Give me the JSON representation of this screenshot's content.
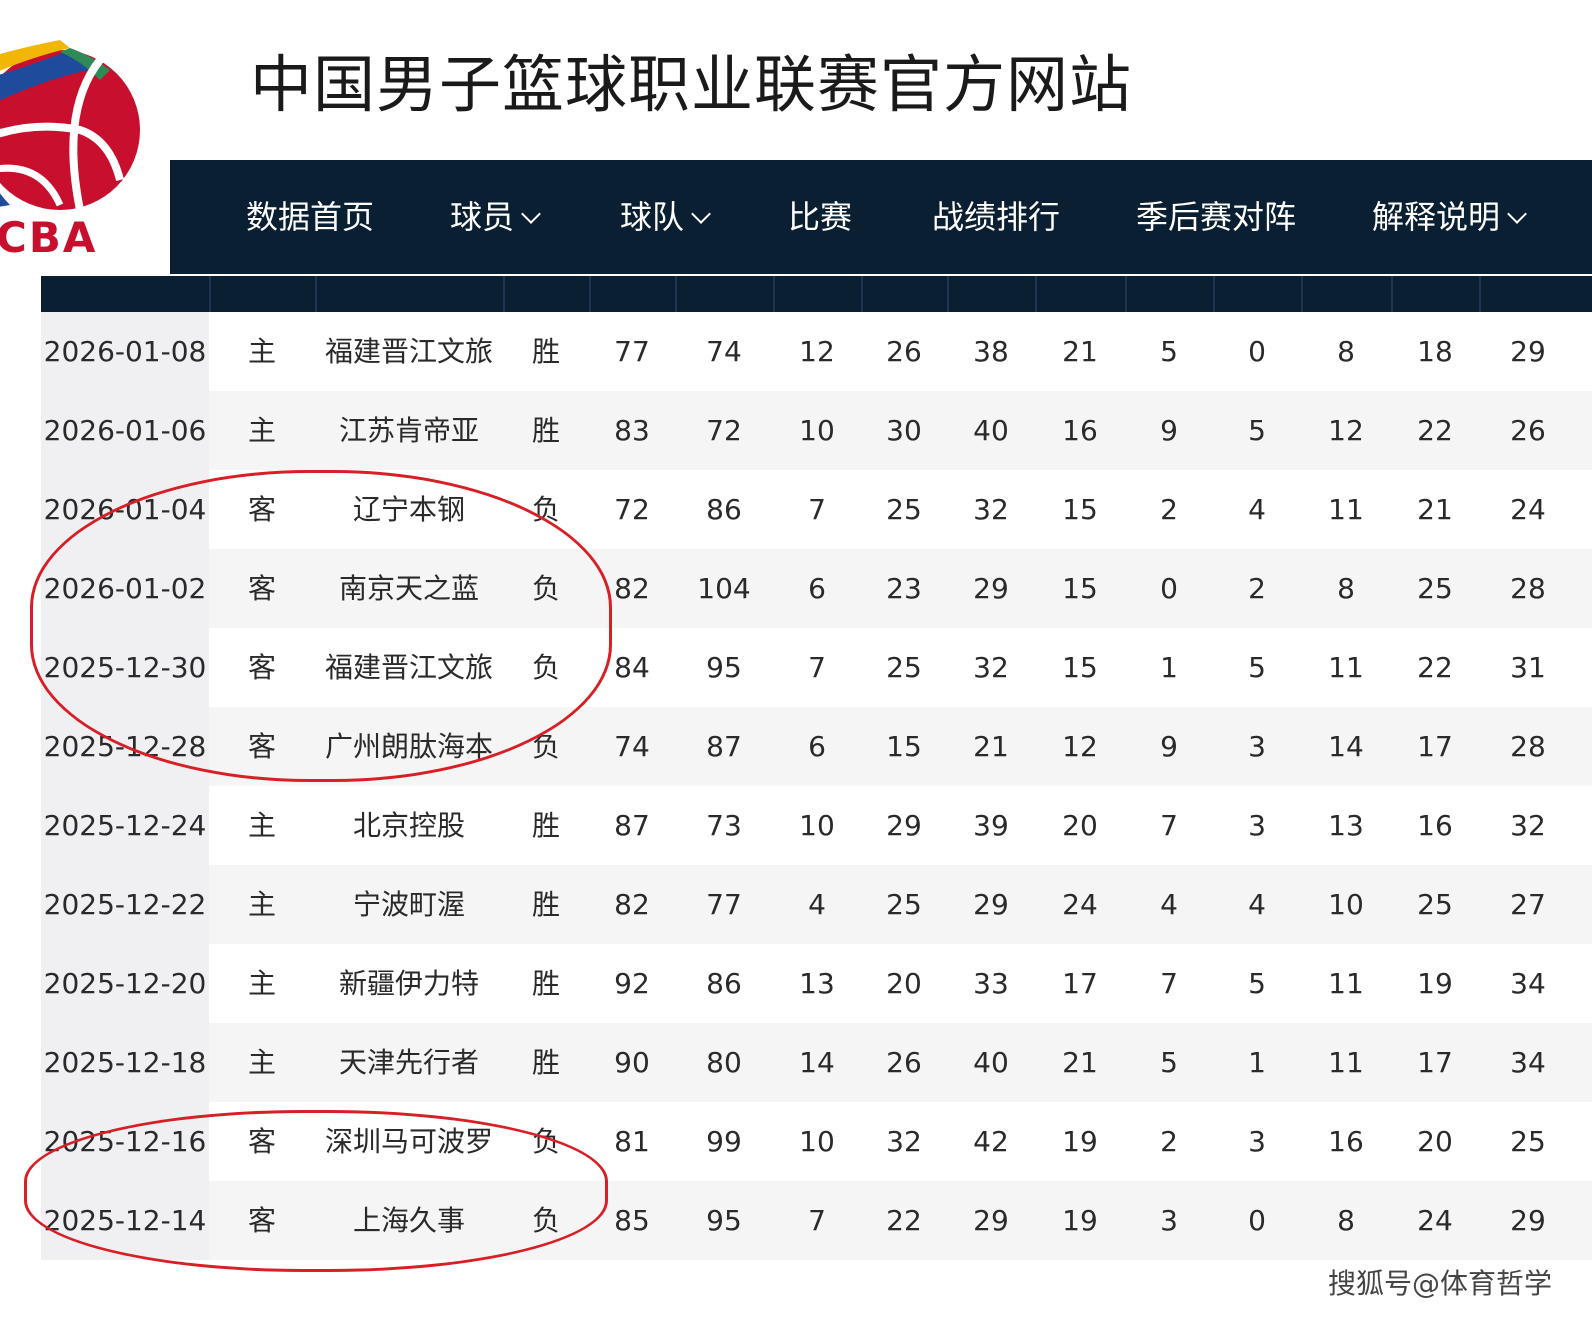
{
  "site": {
    "title": "中国男子篮球职业联赛官方网站",
    "logo_text": "CBA"
  },
  "nav": {
    "items": [
      {
        "label": "数据首页",
        "dropdown": false
      },
      {
        "label": "球员",
        "dropdown": true
      },
      {
        "label": "球队",
        "dropdown": true
      },
      {
        "label": "比赛",
        "dropdown": false
      },
      {
        "label": "战绩排行",
        "dropdown": false
      },
      {
        "label": "季后赛对阵",
        "dropdown": false
      },
      {
        "label": "解释说明",
        "dropdown": true
      }
    ]
  },
  "games": [
    [
      "2026-01-08",
      "主",
      "福建晋江文旅",
      "胜",
      "77",
      "74",
      "12",
      "26",
      "38",
      "21",
      "5",
      "0",
      "8",
      "18",
      "29"
    ],
    [
      "2026-01-06",
      "主",
      "江苏肯帝亚",
      "胜",
      "83",
      "72",
      "10",
      "30",
      "40",
      "16",
      "9",
      "5",
      "12",
      "22",
      "26"
    ],
    [
      "2026-01-04",
      "客",
      "辽宁本钢",
      "负",
      "72",
      "86",
      "7",
      "25",
      "32",
      "15",
      "2",
      "4",
      "11",
      "21",
      "24"
    ],
    [
      "2026-01-02",
      "客",
      "南京天之蓝",
      "负",
      "82",
      "104",
      "6",
      "23",
      "29",
      "15",
      "0",
      "2",
      "8",
      "25",
      "28"
    ],
    [
      "2025-12-30",
      "客",
      "福建晋江文旅",
      "负",
      "84",
      "95",
      "7",
      "25",
      "32",
      "15",
      "1",
      "5",
      "11",
      "22",
      "31"
    ],
    [
      "2025-12-28",
      "客",
      "广州朗肽海本",
      "负",
      "74",
      "87",
      "6",
      "15",
      "21",
      "12",
      "9",
      "3",
      "14",
      "17",
      "28"
    ],
    [
      "2025-12-24",
      "主",
      "北京控股",
      "胜",
      "87",
      "73",
      "10",
      "29",
      "39",
      "20",
      "7",
      "3",
      "13",
      "16",
      "32"
    ],
    [
      "2025-12-22",
      "主",
      "宁波町渥",
      "胜",
      "82",
      "77",
      "4",
      "25",
      "29",
      "24",
      "4",
      "4",
      "10",
      "25",
      "27"
    ],
    [
      "2025-12-20",
      "主",
      "新疆伊力特",
      "胜",
      "92",
      "86",
      "13",
      "20",
      "33",
      "17",
      "7",
      "5",
      "11",
      "19",
      "34"
    ],
    [
      "2025-12-18",
      "主",
      "天津先行者",
      "胜",
      "90",
      "80",
      "14",
      "26",
      "40",
      "21",
      "5",
      "1",
      "11",
      "17",
      "34"
    ],
    [
      "2025-12-16",
      "客",
      "深圳马可波罗",
      "负",
      "81",
      "99",
      "10",
      "32",
      "42",
      "19",
      "2",
      "3",
      "16",
      "20",
      "25"
    ],
    [
      "2025-12-14",
      "客",
      "上海久事",
      "负",
      "85",
      "95",
      "7",
      "22",
      "29",
      "19",
      "3",
      "0",
      "8",
      "24",
      "29"
    ]
  ],
  "highlight_color": "#d81f26",
  "watermark": "搜狐号@体育哲学",
  "icons": {
    "dropdown": "chevron-down-icon",
    "logo": "cba-basketball-logo-icon"
  }
}
